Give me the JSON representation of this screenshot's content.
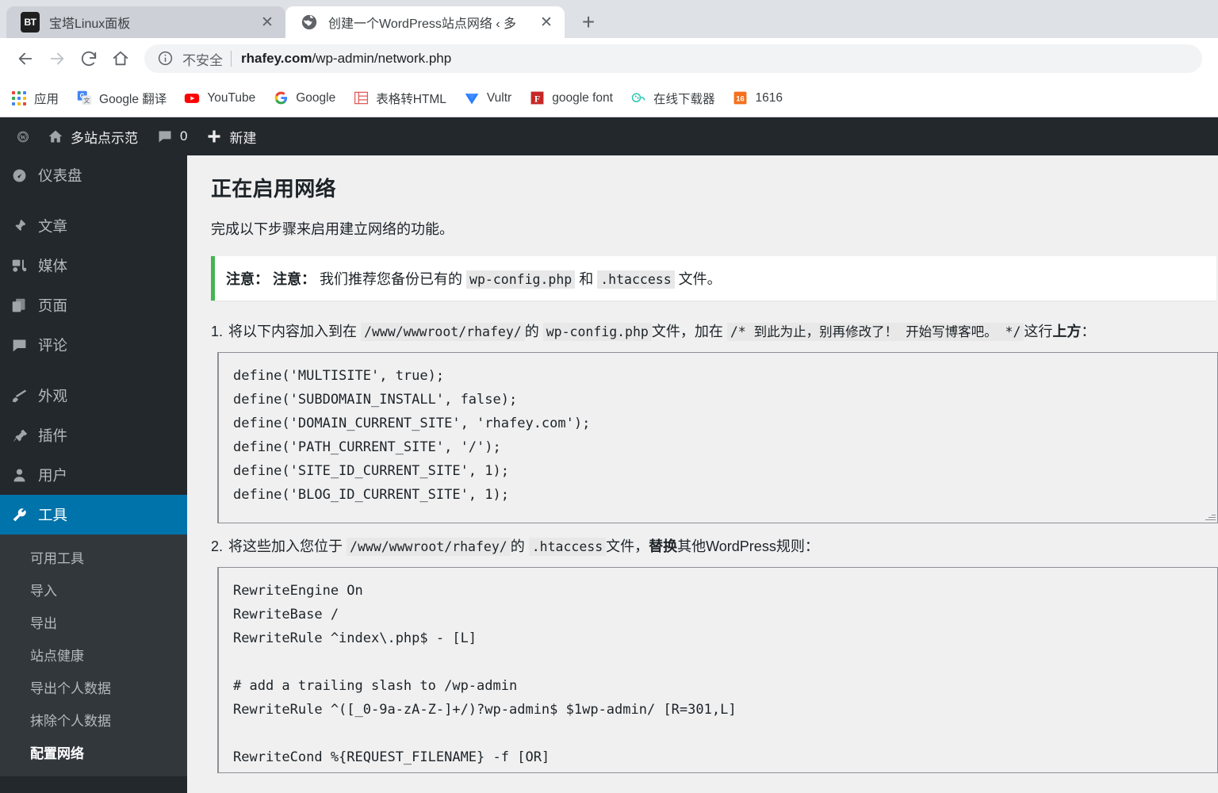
{
  "browser": {
    "tabs": [
      {
        "title": "宝塔Linux面板",
        "favicon": "bt-panel-icon",
        "active": false,
        "close_label": "✕"
      },
      {
        "title": "创建一个WordPress站点网络 ‹ 多",
        "favicon": "globe-icon",
        "active": true,
        "close_label": "✕"
      }
    ],
    "new_tab_label": "+",
    "nav": {
      "back": "back-arrow-icon",
      "forward": "forward-arrow-icon",
      "reload": "reload-icon",
      "home": "home-icon"
    },
    "omnibox": {
      "security_label": "不安全",
      "url_host": "rhafey.com",
      "url_path": "/wp-admin/network.php"
    },
    "bookmarks": [
      {
        "label": "应用",
        "icon": "apps-grid-icon"
      },
      {
        "label": "Google 翻译",
        "icon": "google-translate-icon"
      },
      {
        "label": "YouTube",
        "icon": "youtube-icon"
      },
      {
        "label": "Google",
        "icon": "google-icon"
      },
      {
        "label": "表格转HTML",
        "icon": "table-to-html-icon"
      },
      {
        "label": "Vultr",
        "icon": "vultr-icon"
      },
      {
        "label": "google font",
        "icon": "google-font-icon"
      },
      {
        "label": "在线下载器",
        "icon": "online-downloader-icon"
      },
      {
        "label": "1616",
        "icon": "1616-icon"
      }
    ]
  },
  "adminbar": {
    "logo": "wordpress-logo-icon",
    "site_name": "多站点示范",
    "comment_count": "0",
    "new_label": "新建"
  },
  "sidebar": {
    "items": [
      {
        "label": "仪表盘",
        "icon": "dashboard-icon"
      },
      {
        "label": "文章",
        "icon": "pin-icon"
      },
      {
        "label": "媒体",
        "icon": "media-icon"
      },
      {
        "label": "页面",
        "icon": "pages-icon"
      },
      {
        "label": "评论",
        "icon": "comments-icon"
      },
      {
        "label": "外观",
        "icon": "appearance-brush-icon"
      },
      {
        "label": "插件",
        "icon": "plugins-plug-icon"
      },
      {
        "label": "用户",
        "icon": "users-icon"
      },
      {
        "label": "工具",
        "icon": "tools-wrench-icon",
        "current": true
      }
    ],
    "submenu": [
      {
        "label": "可用工具"
      },
      {
        "label": "导入"
      },
      {
        "label": "导出"
      },
      {
        "label": "站点健康"
      },
      {
        "label": "导出个人数据"
      },
      {
        "label": "抹除个人数据"
      },
      {
        "label": "配置网络",
        "current": true
      }
    ]
  },
  "page": {
    "title": "正在启用网络",
    "lead": "完成以下步骤来启用建立网络的功能。",
    "notice": {
      "strong1": "注意：",
      "strong2": "注意：",
      "text_before": "我们推荐您备份已有的",
      "code1": "wp-config.php",
      "text_mid": "和",
      "code2": ".htaccess",
      "text_after": "文件。"
    },
    "steps": [
      {
        "num": "1.",
        "t1": "将以下内容加入到在",
        "c1": "/www/wwwroot/rhafey/",
        "t2": "的",
        "c2": "wp-config.php",
        "t3": "文件，加在",
        "c3": "/* 到此为止，别再修改了！ 开始写博客吧。 */",
        "t4": "这行",
        "b1": "上方",
        "t5": "：",
        "code": "define('MULTISITE', true);\ndefine('SUBDOMAIN_INSTALL', false);\ndefine('DOMAIN_CURRENT_SITE', 'rhafey.com');\ndefine('PATH_CURRENT_SITE', '/');\ndefine('SITE_ID_CURRENT_SITE', 1);\ndefine('BLOG_ID_CURRENT_SITE', 1);"
      },
      {
        "num": "2.",
        "t1": "将这些加入您位于",
        "c1": "/www/wwwroot/rhafey/",
        "t2": "的",
        "c2": ".htaccess",
        "t3": "文件，",
        "b1": "替换",
        "t4": "其他WordPress规则：",
        "code": "RewriteEngine On\nRewriteBase /\nRewriteRule ^index\\.php$ - [L]\n\n# add a trailing slash to /wp-admin\nRewriteRule ^([_0-9a-zA-Z-]+/)?wp-admin$ $1wp-admin/ [R=301,L]\n\nRewriteCond %{REQUEST_FILENAME} -f [OR]"
      }
    ]
  },
  "colors": {
    "accent_blue": "#0073aa",
    "admin_dark": "#23282d",
    "submenu_dark": "#32373c",
    "notice_green": "#46b450",
    "page_bg": "#f0f0f1"
  }
}
